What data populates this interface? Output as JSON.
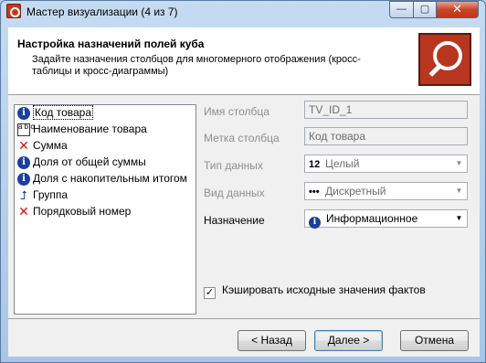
{
  "window": {
    "title": "Мастер визуализации (4 из 7)",
    "controls": {
      "minimize": "—",
      "maximize": "▢",
      "close": "✕"
    }
  },
  "header": {
    "title": "Настройка назначений полей куба",
    "subtitle": "Задайте назначения столбцов для многомерного отображения (кросс-таблицы и кросс-диаграммы)",
    "logo_icon": "magnifier-icon"
  },
  "fields_list": {
    "items": [
      {
        "label": "Код товара",
        "icon": "info-icon",
        "glyph": "i",
        "selected": true
      },
      {
        "label": "Наименование товара",
        "icon": "abc-icon",
        "glyph": "a b c",
        "selected": false
      },
      {
        "label": "Сумма",
        "icon": "cross-icon",
        "glyph": "✕",
        "selected": false
      },
      {
        "label": "Доля от общей суммы",
        "icon": "info-icon",
        "glyph": "i",
        "selected": false
      },
      {
        "label": "Доля с накопительным итогом",
        "icon": "info-icon",
        "glyph": "i",
        "selected": false
      },
      {
        "label": "Группа",
        "icon": "group-icon",
        "glyph": "⮥",
        "selected": false
      },
      {
        "label": "Порядковый номер",
        "icon": "cross-icon",
        "glyph": "✕",
        "selected": false
      }
    ]
  },
  "form": {
    "column_name_label": "Имя столбца",
    "column_name_value": "TV_ID_1",
    "column_caption_label": "Метка столбца",
    "column_caption_value": "Код товара",
    "data_type_label": "Тип данных",
    "data_type_icon": "12",
    "data_type_value": "Целый",
    "data_kind_label": "Вид данных",
    "data_kind_icon": "•••",
    "data_kind_value": "Дискретный",
    "purpose_label": "Назначение",
    "purpose_icon": "i",
    "purpose_value": "Информационное",
    "dropdown_arrow": "▼",
    "cache_checkbox_label": "Кэшировать исходные значения фактов",
    "cache_checked": true,
    "check_mark": "✓"
  },
  "footer": {
    "back_label": "< Назад",
    "next_label": "Далее >",
    "cancel_label": "Отмена"
  }
}
